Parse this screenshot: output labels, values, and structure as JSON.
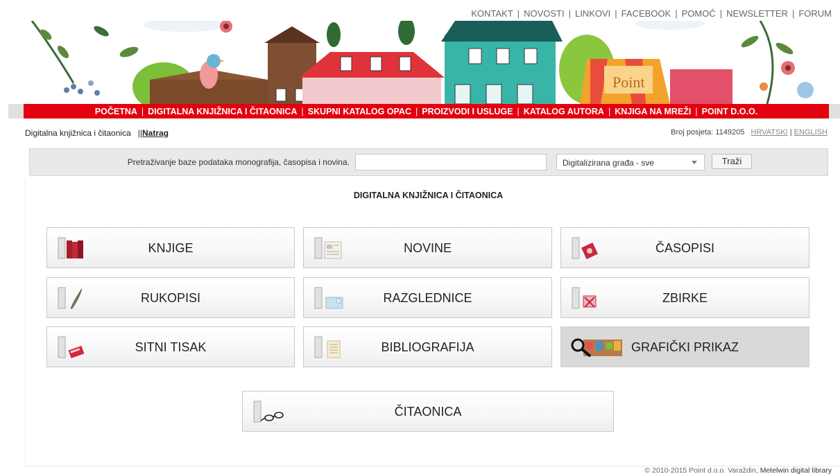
{
  "top_links": [
    "KONTAKT",
    "NOVOSTI",
    "LINKOVI",
    "FACEBOOK",
    "POMOĆ",
    "NEWSLETTER",
    "FORUM"
  ],
  "banner": {
    "shop_sign": "Point"
  },
  "nav": [
    "POČETNA",
    "DIGITALNA KNJIŽNICA I ČITAONICA",
    "SKUPNI KATALOG OPAC",
    "PROIZVODI I USLUGE",
    "KATALOG AUTORA",
    "KNJIGA NA MREŽI",
    "POINT D.O.O."
  ],
  "subhead": {
    "section": "Digitalna knjižnica i čitaonica",
    "divider": "||",
    "back": "Natrag",
    "visits_label": "Broj posjeta:",
    "visits_count": "1149205",
    "lang_hr": "HRVATSKI",
    "lang_sep": "|",
    "lang_en": "ENGLISH"
  },
  "search": {
    "label": "Pretraživanje baze podataka monografija, časopisa i novina.",
    "value": "",
    "select_value": "Digitalizirana građa - sve",
    "button": "Traži"
  },
  "main": {
    "title": "DIGITALNA KNJIŽNICA I ČITAONICA",
    "tiles": [
      {
        "label": "KNJIGE",
        "icon": "books-icon"
      },
      {
        "label": "NOVINE",
        "icon": "newspaper-icon"
      },
      {
        "label": "ČASOPISI",
        "icon": "magazine-icon"
      },
      {
        "label": "RUKOPISI",
        "icon": "quill-icon"
      },
      {
        "label": "RAZGLEDNICE",
        "icon": "postcard-icon"
      },
      {
        "label": "ZBIRKE",
        "icon": "collection-icon"
      },
      {
        "label": "SITNI TISAK",
        "icon": "small-print-icon"
      },
      {
        "label": "BIBLIOGRAFIJA",
        "icon": "bibliography-icon"
      },
      {
        "label": "GRAFIČKI PRIKAZ",
        "icon": "magnifier-icon"
      },
      {
        "label": "ČITAONICA",
        "icon": "glasses-icon"
      }
    ]
  },
  "footer": {
    "copyright": "© 2010-2015 Point d.o.o. Varaždin, ",
    "product": "Metelwin digital library"
  },
  "colors": {
    "nav_red": "#e3000f",
    "tile_active": "#d9d9d9",
    "search_bg": "#e9e9e9"
  }
}
